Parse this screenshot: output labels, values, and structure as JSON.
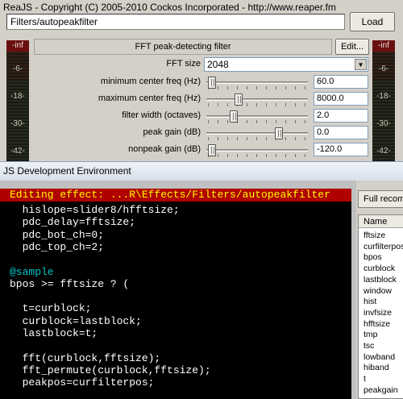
{
  "reajs": {
    "title": "ReaJS - Copyright (C) 2005-2010 Cockos Incorporated - http://www.reaper.fm",
    "path": "Filters/autopeakfilter",
    "load_label": "Load",
    "effect_name": "FFT peak-detecting filter",
    "edit_label": "Edit...",
    "meter_labels": [
      "-inf",
      "-6-",
      "-18-",
      "-30-",
      "-42-"
    ],
    "fft_size_label": "FFT size",
    "fft_size_value": "2048",
    "sliders": [
      {
        "label": "minimum center freq (Hz)",
        "value": "60.0",
        "position": 0.02
      },
      {
        "label": "maximum center freq (Hz)",
        "value": "8000.0",
        "position": 0.3
      },
      {
        "label": "filter width (octaves)",
        "value": "2.0",
        "position": 0.25
      },
      {
        "label": "peak gain (dB)",
        "value": "0.0",
        "position": 0.73
      },
      {
        "label": "nonpeak gain (dB)",
        "value": "-120.0",
        "position": 0.02
      }
    ]
  },
  "jsdev": {
    "title": "JS Development Environment",
    "editor_header": "Editing effect: ...R\\Effects/Filters/autopeakfilter",
    "full_recompile_label": "Full recomp",
    "var_list_header": "Name",
    "variables": [
      "fftsize",
      "curfilterpos",
      "bpos",
      "curblock",
      "lastblock",
      "window",
      "hist",
      "invfsize",
      "hfftsize",
      "tmp",
      "tsc",
      "lowband",
      "hiband",
      "t",
      "peakgain"
    ],
    "code": [
      {
        "text": "  hislope=slider8/hfftsize;",
        "kw": false
      },
      {
        "text": "  pdc_delay=fftsize;",
        "kw": false
      },
      {
        "text": "  pdc_bot_ch=0;",
        "kw": false
      },
      {
        "text": "  pdc_top_ch=2;",
        "kw": false
      },
      {
        "text": "",
        "kw": false
      },
      {
        "text": "@sample",
        "kw": true
      },
      {
        "text": "bpos >= fftsize ? (",
        "kw": false
      },
      {
        "text": "",
        "kw": false
      },
      {
        "text": "  t=curblock;",
        "kw": false
      },
      {
        "text": "  curblock=lastblock;",
        "kw": false
      },
      {
        "text": "  lastblock=t;",
        "kw": false
      },
      {
        "text": "",
        "kw": false
      },
      {
        "text": "  fft(curblock,fftsize);",
        "kw": false
      },
      {
        "text": "  fft_permute(curblock,fftsize);",
        "kw": false
      },
      {
        "text": "  peakpos=curfilterpos;",
        "kw": false
      }
    ]
  }
}
